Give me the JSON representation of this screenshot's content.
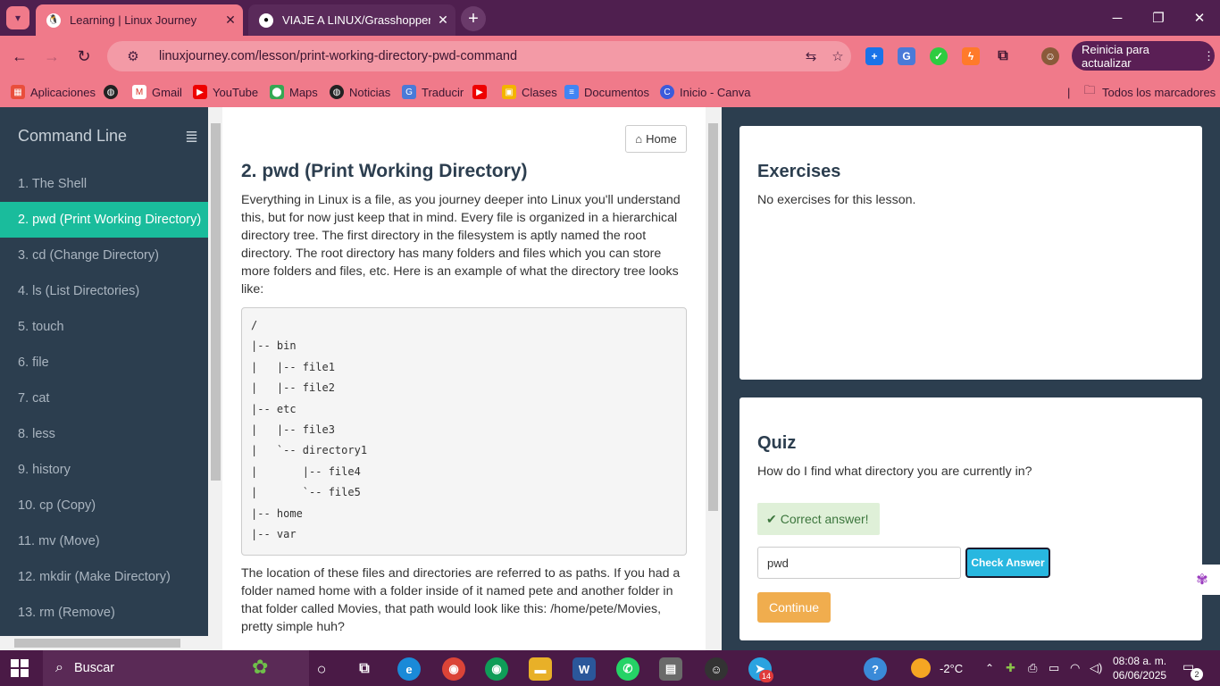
{
  "browser": {
    "tabs": [
      {
        "title": "Learning | Linux Journey",
        "active": true
      },
      {
        "title": "VIAJE A LINUX/Grasshopper/Lin",
        "active": false
      }
    ],
    "url": "linuxjourney.com/lesson/print-working-directory-pwd-command",
    "update_label": "Reinicia para actualizar",
    "bookmarks": [
      "Aplicaciones",
      "Gmail",
      "YouTube",
      "Maps",
      "Noticias",
      "Traducir",
      "Clases",
      "Documentos",
      "Inicio - Canva"
    ],
    "all_bookmarks": "Todos los marcadores"
  },
  "sidebar": {
    "title": "Command Line",
    "items": [
      "1. The Shell",
      "2. pwd (Print Working Directory)",
      "3. cd (Change Directory)",
      "4. ls (List Directories)",
      "5. touch",
      "6. file",
      "7. cat",
      "8. less",
      "9. history",
      "10. cp (Copy)",
      "11. mv (Move)",
      "12. mkdir (Make Directory)",
      "13. rm (Remove)"
    ],
    "active_index": 1
  },
  "lesson": {
    "home_label": "Home",
    "title": "2. pwd (Print Working Directory)",
    "para1": "Everything in Linux is a file, as you journey deeper into Linux you'll understand this, but for now just keep that in mind. Every file is organized in a hierarchical directory tree. The first directory in the filesystem is aptly named the root directory. The root directory has many folders and files which you can store more folders and files, etc. Here is an example of what the directory tree looks like:",
    "code": "/\n|-- bin\n|   |-- file1\n|   |-- file2\n|-- etc\n|   |-- file3\n|   `-- directory1\n|       |-- file4\n|       `-- file5\n|-- home\n|-- var",
    "para2": "The location of these files and directories are referred to as paths. If you had a folder named home with a folder inside of it named pete and another folder in that folder called Movies, that path would look like this: /home/pete/Movies, pretty simple huh?"
  },
  "exercises": {
    "title": "Exercises",
    "text": "No exercises for this lesson."
  },
  "quiz": {
    "title": "Quiz",
    "question": "How do I find what directory you are currently in?",
    "feedback": "Correct answer!",
    "answer": "pwd",
    "check_label": "Check Answer",
    "continue_label": "Continue"
  },
  "taskbar": {
    "search": "Buscar",
    "weather": "-2°C",
    "time": "08:08 a. m.",
    "date": "06/06/2025",
    "telegram_badge": "14",
    "notif_count": "2"
  }
}
